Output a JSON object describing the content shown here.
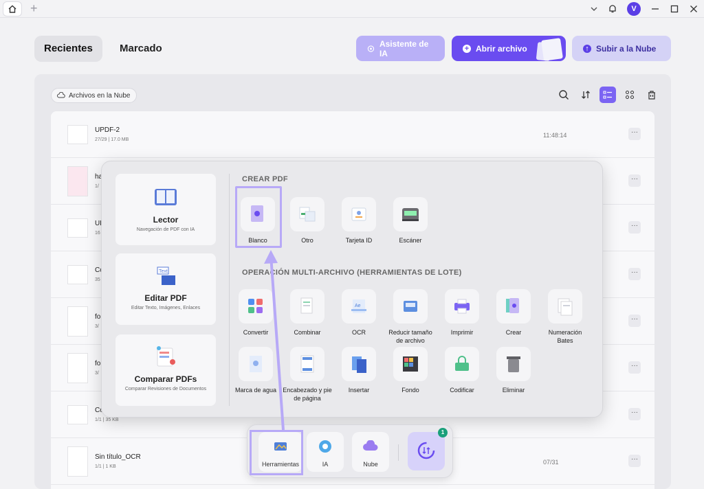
{
  "titlebar": {
    "avatar_letter": "V"
  },
  "nav": {
    "tabs": [
      {
        "label": "Recientes",
        "active": true
      },
      {
        "label": "Marcado",
        "active": false
      }
    ],
    "ai_assistant_label": "Asistente de IA",
    "open_file_label": "Abrir archivo",
    "upload_cloud_label": "Subir a la Nube"
  },
  "toolbar": {
    "cloud_files_label": "Archivos en la Nube"
  },
  "files": [
    {
      "name": "UPDF-2",
      "meta": "27/29 | 17.0 MB",
      "time": "11:48:14"
    },
    {
      "name": "ha",
      "meta": "1/",
      "time": ""
    },
    {
      "name": "UP",
      "meta": "16",
      "time": ""
    },
    {
      "name": "Co",
      "meta": "35",
      "time": ""
    },
    {
      "name": "fo",
      "meta": "3/",
      "time": ""
    },
    {
      "name": "fo",
      "meta": "3/",
      "time": ""
    },
    {
      "name": "Co",
      "meta": "1/1 | 35 KB",
      "time": ""
    },
    {
      "name": "Sin título_OCR",
      "meta": "1/1 | 1 KB",
      "time": "07/31"
    }
  ],
  "overlay": {
    "left_cards": [
      {
        "title": "Lector",
        "subtitle": "Navegación de PDF con IA"
      },
      {
        "title": "Editar PDF",
        "subtitle": "Editar Texto, Imágenes, Enlaces"
      },
      {
        "title": "Comparar PDFs",
        "subtitle": "Comparar Revisiones de Documentos"
      }
    ],
    "create_title": "CREAR PDF",
    "create_tools": [
      "Blanco",
      "Otro",
      "Tarjeta ID",
      "Escáner"
    ],
    "batch_title": "OPERACIÓN MULTI-ARCHIVO (HERRAMIENTAS DE LOTE)",
    "batch_row1": [
      "Convertir",
      "Combinar",
      "OCR",
      "Reducir tamaño de archivo",
      "Imprimir",
      "Crear",
      "Numeración Bates"
    ],
    "batch_row2": [
      "Marca de agua",
      "Encabezado y pie de página",
      "Insertar",
      "Fondo",
      "Codificar",
      "Eliminar"
    ]
  },
  "dock": {
    "items": [
      "Herramientas",
      "IA",
      "Nube"
    ],
    "sync_badge": "1"
  },
  "colors": {
    "accent": "#6a4cf0",
    "highlight": "#b7a9f7",
    "badge": "#1aa07a"
  }
}
